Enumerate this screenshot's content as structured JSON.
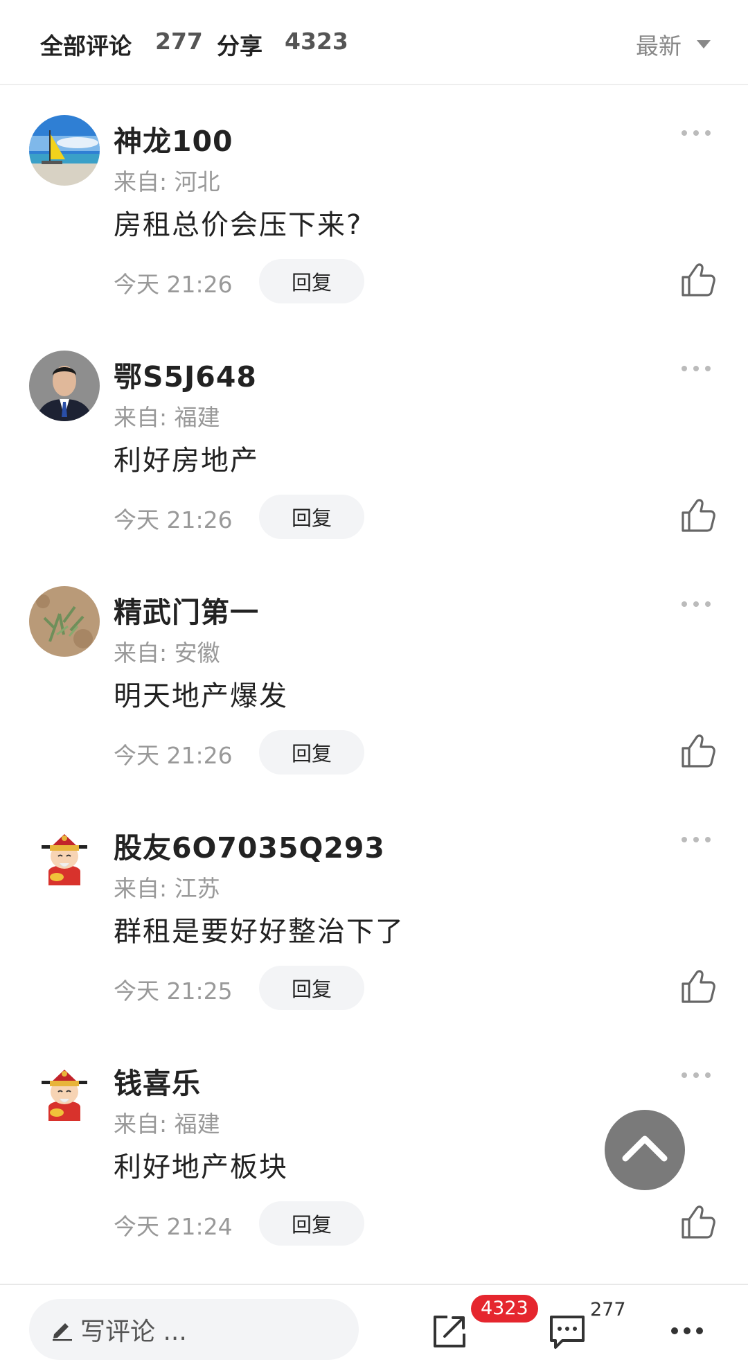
{
  "header": {
    "all_comments_label": "全部评论",
    "comment_count": "277",
    "share_label": "分享",
    "share_count": "4323",
    "sort_label": "最新"
  },
  "comments": [
    {
      "name": "神龙100",
      "location": "来自: 河北",
      "text": "房租总价会压下来?",
      "time": "今天 21:26",
      "reply_label": "回复",
      "avatar": "sailboat-photo"
    },
    {
      "name": "鄂S5J648",
      "location": "来自: 福建",
      "text": "利好房地产",
      "time": "今天 21:26",
      "reply_label": "回复",
      "avatar": "man-in-suit-photo"
    },
    {
      "name": "精武门第一",
      "location": "来自: 安徽",
      "text": "明天地产爆发",
      "time": "今天 21:26",
      "reply_label": "回复",
      "avatar": "grass-field-photo"
    },
    {
      "name": "股友6O7035Q293",
      "location": "来自: 江苏",
      "text": "群租是要好好整治下了",
      "time": "今天 21:25",
      "reply_label": "回复",
      "avatar": "fortune-god-cartoon"
    },
    {
      "name": "钱喜乐",
      "location": "来自: 福建",
      "text": "利好地产板块",
      "time": "今天 21:24",
      "reply_label": "回复",
      "avatar": "fortune-god-cartoon"
    }
  ],
  "bottom_bar": {
    "input_placeholder": "写评论 ...",
    "share_badge": "4323",
    "comment_count": "277"
  },
  "colors": {
    "badge_red": "#e5262e",
    "muted_text": "#999999",
    "reply_bg": "#f3f4f6",
    "scroll_top_bg": "#7a7a7a"
  }
}
